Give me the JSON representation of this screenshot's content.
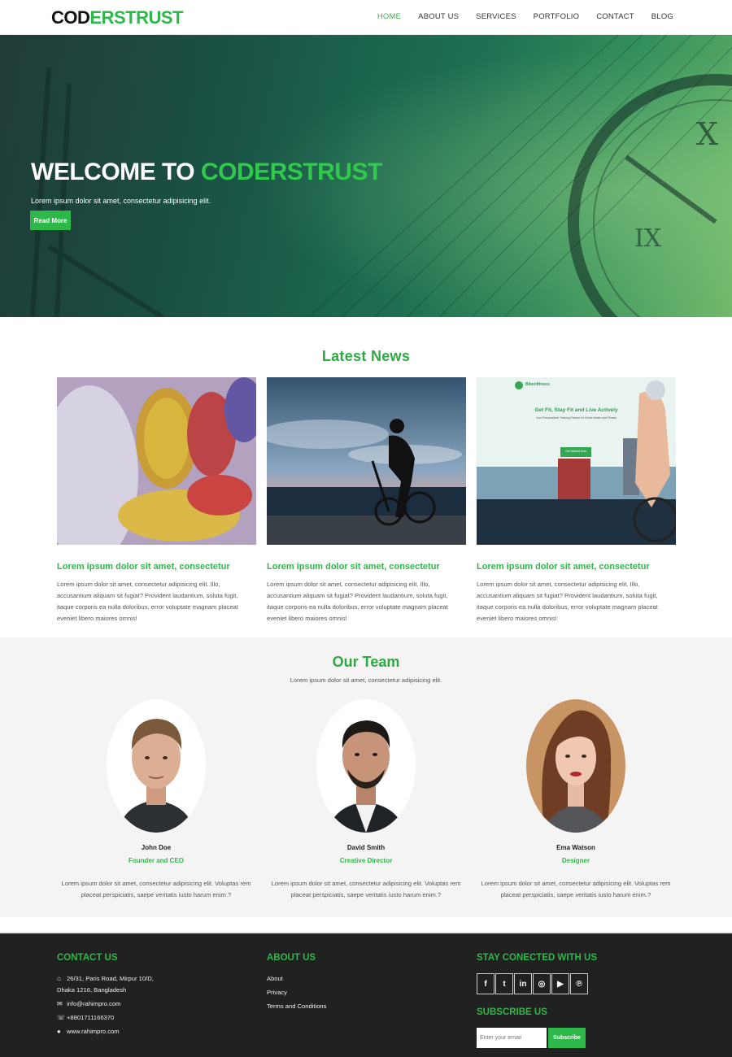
{
  "brand": {
    "part1": "COD",
    "part2": "ERSTRUST"
  },
  "nav": [
    {
      "label": "HOME",
      "active": true
    },
    {
      "label": "ABOUT US",
      "active": false
    },
    {
      "label": "SERVICES",
      "active": false
    },
    {
      "label": "PORTFOLIO",
      "active": false
    },
    {
      "label": "CONTACT",
      "active": false
    },
    {
      "label": "BLOG",
      "active": false
    }
  ],
  "hero": {
    "title_white": "WELCOME TO ",
    "title_green": "CODERSTRUST",
    "subtitle": "Lorem ipsum dolor sit amet, consectetur adipisicing elit.",
    "button": "Read More"
  },
  "news": {
    "title": "Latest News",
    "cards": [
      {
        "title": "Lorem ipsum dolor sit amet, consectetur",
        "text": "Lorem ipsum dolor sit amet, consectetur adipisicing elit. Illo, accusantium aliquam sit fugiat? Provident laudantium, soluta fugit, itaque corporis ea nulla doloribus, error voluptate magnam placeat eveniet libero maiores omnis!"
      },
      {
        "title": "Lorem ipsum dolor sit amet, consectetur",
        "text": "Lorem ipsum dolor sit amet, consectetur adipisicing elit. Illo, accusantium aliquam sit fugiat? Provident laudantium, soluta fugit, itaque corporis ea nulla doloribus, error voluptate magnam placeat eveniet libero maiores omnis!"
      },
      {
        "title": "Lorem ipsum dolor sit amet, consectetur",
        "text": "Lorem ipsum dolor sit amet, consectetur adipisicing elit. Illo, accusantium aliquam sit fugiat? Provident laudantium, soluta fugit, itaque corporis ea nulla doloribus, error voluptate magnam placeat eveniet libero maiores omnis!"
      }
    ],
    "card3_mock": {
      "logo": "Bikenfitness",
      "heading": "Get Fit, Stay Fit and Live Actively",
      "sub": "Your Personalized Training Partner for Great Health and Fitness",
      "button": "Get Started Now"
    }
  },
  "team": {
    "title": "Our Team",
    "subtitle": "Lorem ipsum dolor sit amet, consectetur adipisicing elit.",
    "members": [
      {
        "name": "John Doe",
        "role": "Founder and CEO",
        "bio": "Lorem ipsum dolor sit amet, consectetur adipisicing elit. Voluptas rem placeat perspiciatis, saepe veritatis iusto harum enim.?"
      },
      {
        "name": "David Smith",
        "role": "Creative Director",
        "bio": "Lorem ipsum dolor sit amet, consectetur adipisicing elit. Voluptas rem placeat perspiciatis, saepe veritatis iusto harum enim.?"
      },
      {
        "name": "Ema Watson",
        "role": "Designer",
        "bio": "Lorem ipsum dolor sit amet, consectetur adipisicing elit. Voluptas rem placeat perspiciatis, saepe veritatis iusto harum enim.?"
      }
    ]
  },
  "footer": {
    "contact": {
      "title": "CONTACT US",
      "address1": "26/31, Paris Road, Mirpur 10/D,",
      "address2": "Dhaka 1216, Bangladesh",
      "email": "info@rahimpro.com",
      "phone": "+8801711166370",
      "web": "www.rahimpro.com"
    },
    "about": {
      "title": "ABOUT US",
      "links": [
        "About",
        "Privacy",
        "Terms and Conditions"
      ]
    },
    "connect": {
      "title": "STAY CONECTED WITH US",
      "social": [
        {
          "icon": "facebook-icon",
          "glyph": "f"
        },
        {
          "icon": "twitter-icon",
          "glyph": "t"
        },
        {
          "icon": "linkedin-icon",
          "glyph": "in"
        },
        {
          "icon": "instagram-icon",
          "glyph": "◎"
        },
        {
          "icon": "youtube-icon",
          "glyph": "▶"
        },
        {
          "icon": "pinterest-icon",
          "glyph": "℗"
        }
      ]
    },
    "subscribe": {
      "title": "SUBSCRIBE US",
      "placeholder": "Enter your email",
      "button": "Subscribe"
    }
  },
  "colors": {
    "accent": "#2fb84a",
    "footer_bg": "#212121",
    "team_bg": "#f4f4f4"
  }
}
